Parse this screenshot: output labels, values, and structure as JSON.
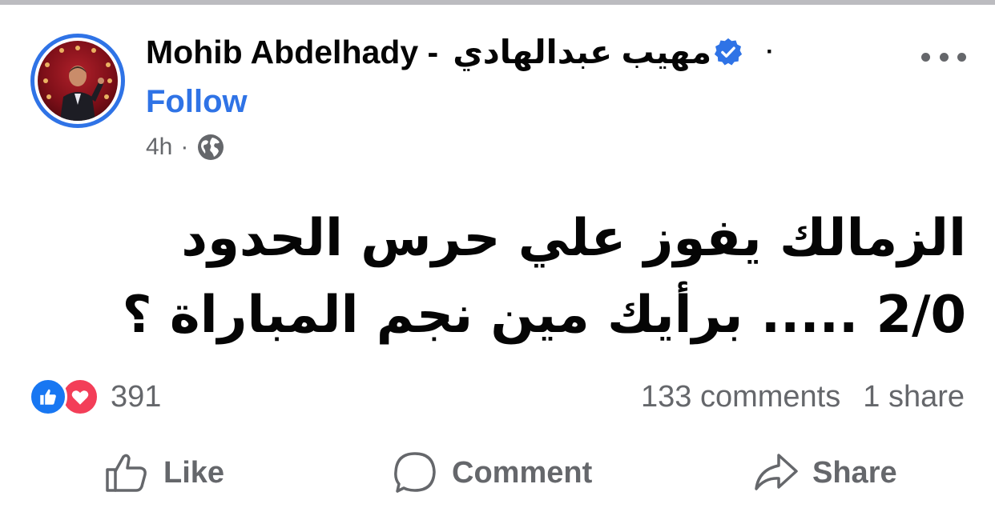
{
  "post": {
    "author_name": "Mohib Abdelhady -",
    "author_name_arabic": "مهيب عبدالهادي",
    "dot": "·",
    "follow_label": "Follow",
    "time": "4h",
    "meta_sep": "·",
    "audience_icon": "globe-icon",
    "more_icon": "more-options-icon",
    "verified_color": "#2f73e6",
    "text_line1": "الزمالك يفوز علي حرس الحدود",
    "text_line2": "2/0 ..... برأيك مين نجم المباراة ؟"
  },
  "engagement": {
    "reactions_count": "391",
    "comments": "133 comments",
    "shares": "1 share",
    "reaction_icons": [
      "like-reaction-icon",
      "love-reaction-icon"
    ]
  },
  "actions": {
    "like_label": "Like",
    "comment_label": "Comment",
    "share_label": "Share"
  },
  "colors": {
    "accent": "#2f73e6",
    "secondary_text": "#65676b",
    "primary_text": "#050505",
    "like_blue": "#1877f2",
    "love_red": "#f33e58"
  }
}
